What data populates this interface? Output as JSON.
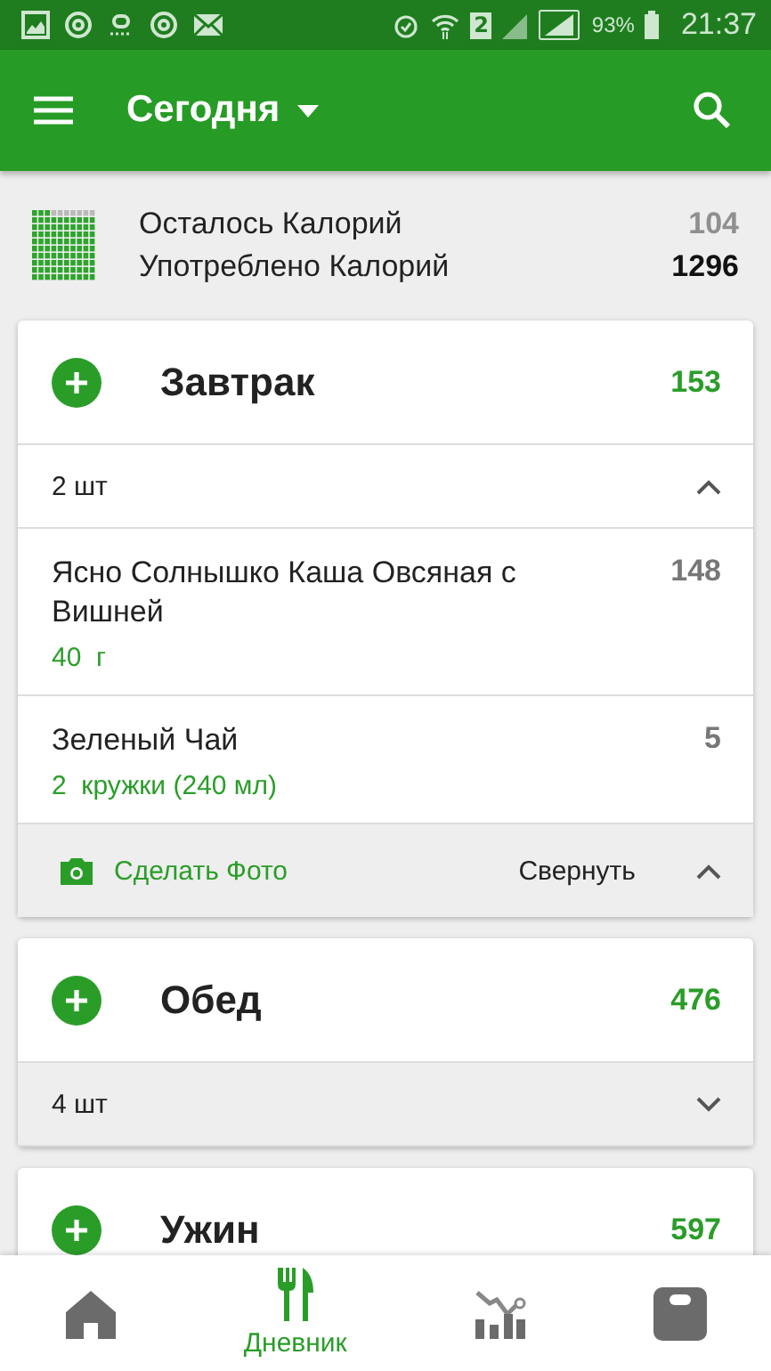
{
  "status_bar": {
    "sim_label": "2",
    "battery": "93%",
    "time": "21:37"
  },
  "toolbar": {
    "title": "Сегодня"
  },
  "summary": {
    "rows": [
      {
        "label": "Осталось Калорий",
        "value": "104",
        "kind": "remaining"
      },
      {
        "label": "Употреблено Калорий",
        "value": "1296",
        "kind": "consumed"
      }
    ]
  },
  "meals": [
    {
      "name": "Завтрак",
      "calories": "153",
      "count": "2 шт",
      "expanded": true,
      "items": [
        {
          "name": "Ясно Солнышко Каша Овсяная с Вишней",
          "amount": "40  г",
          "calories": "148"
        },
        {
          "name": "Зеленый Чай",
          "amount": "2  кружки (240 мл)",
          "calories": "5"
        }
      ],
      "photo_action": "Сделать Фото",
      "collapse_action": "Свернуть"
    },
    {
      "name": "Обед",
      "calories": "476",
      "count": "4 шт",
      "expanded": false
    },
    {
      "name": "Ужин",
      "calories": "597"
    }
  ],
  "bottom_nav": [
    {
      "kind": "home",
      "selected": false
    },
    {
      "kind": "diary",
      "label": "Дневник",
      "selected": true
    },
    {
      "kind": "chart",
      "selected": false
    },
    {
      "kind": "scale",
      "selected": false
    }
  ]
}
